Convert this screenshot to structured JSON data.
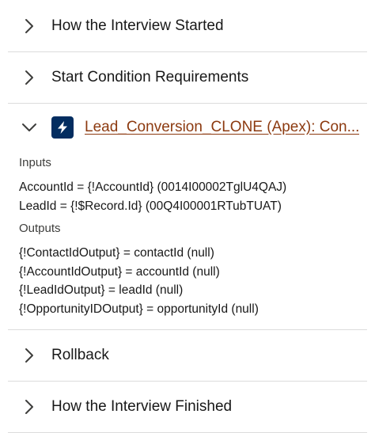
{
  "sections": {
    "how_started": {
      "label": "How the Interview Started",
      "expanded": false
    },
    "start_condition": {
      "label": "Start Condition Requirements",
      "expanded": false
    },
    "apex_action": {
      "label": "Lead_Conversion_CLONE (Apex): Con...",
      "icon": "lightning-bolt-icon",
      "expanded": true,
      "inputs_label": "Inputs",
      "inputs": [
        "AccountId = {!AccountId} (0014I00002TglU4QAJ)",
        "LeadId = {!$Record.Id} (00Q4I00001RTubTUAT)"
      ],
      "outputs_label": "Outputs",
      "outputs": [
        "{!ContactIdOutput} = contactId (null)",
        "{!AccountIdOutput} = accountId (null)",
        "{!LeadIdOutput} = leadId (null)",
        "{!OpportunityIDOutput} = opportunityId (null)"
      ]
    },
    "rollback": {
      "label": "Rollback",
      "expanded": false
    },
    "how_finished": {
      "label": "How the Interview Finished",
      "expanded": false
    }
  },
  "colors": {
    "link": "#8c3a10",
    "badge": "#032d60",
    "divider": "#dcdcdc",
    "text": "#181818"
  }
}
